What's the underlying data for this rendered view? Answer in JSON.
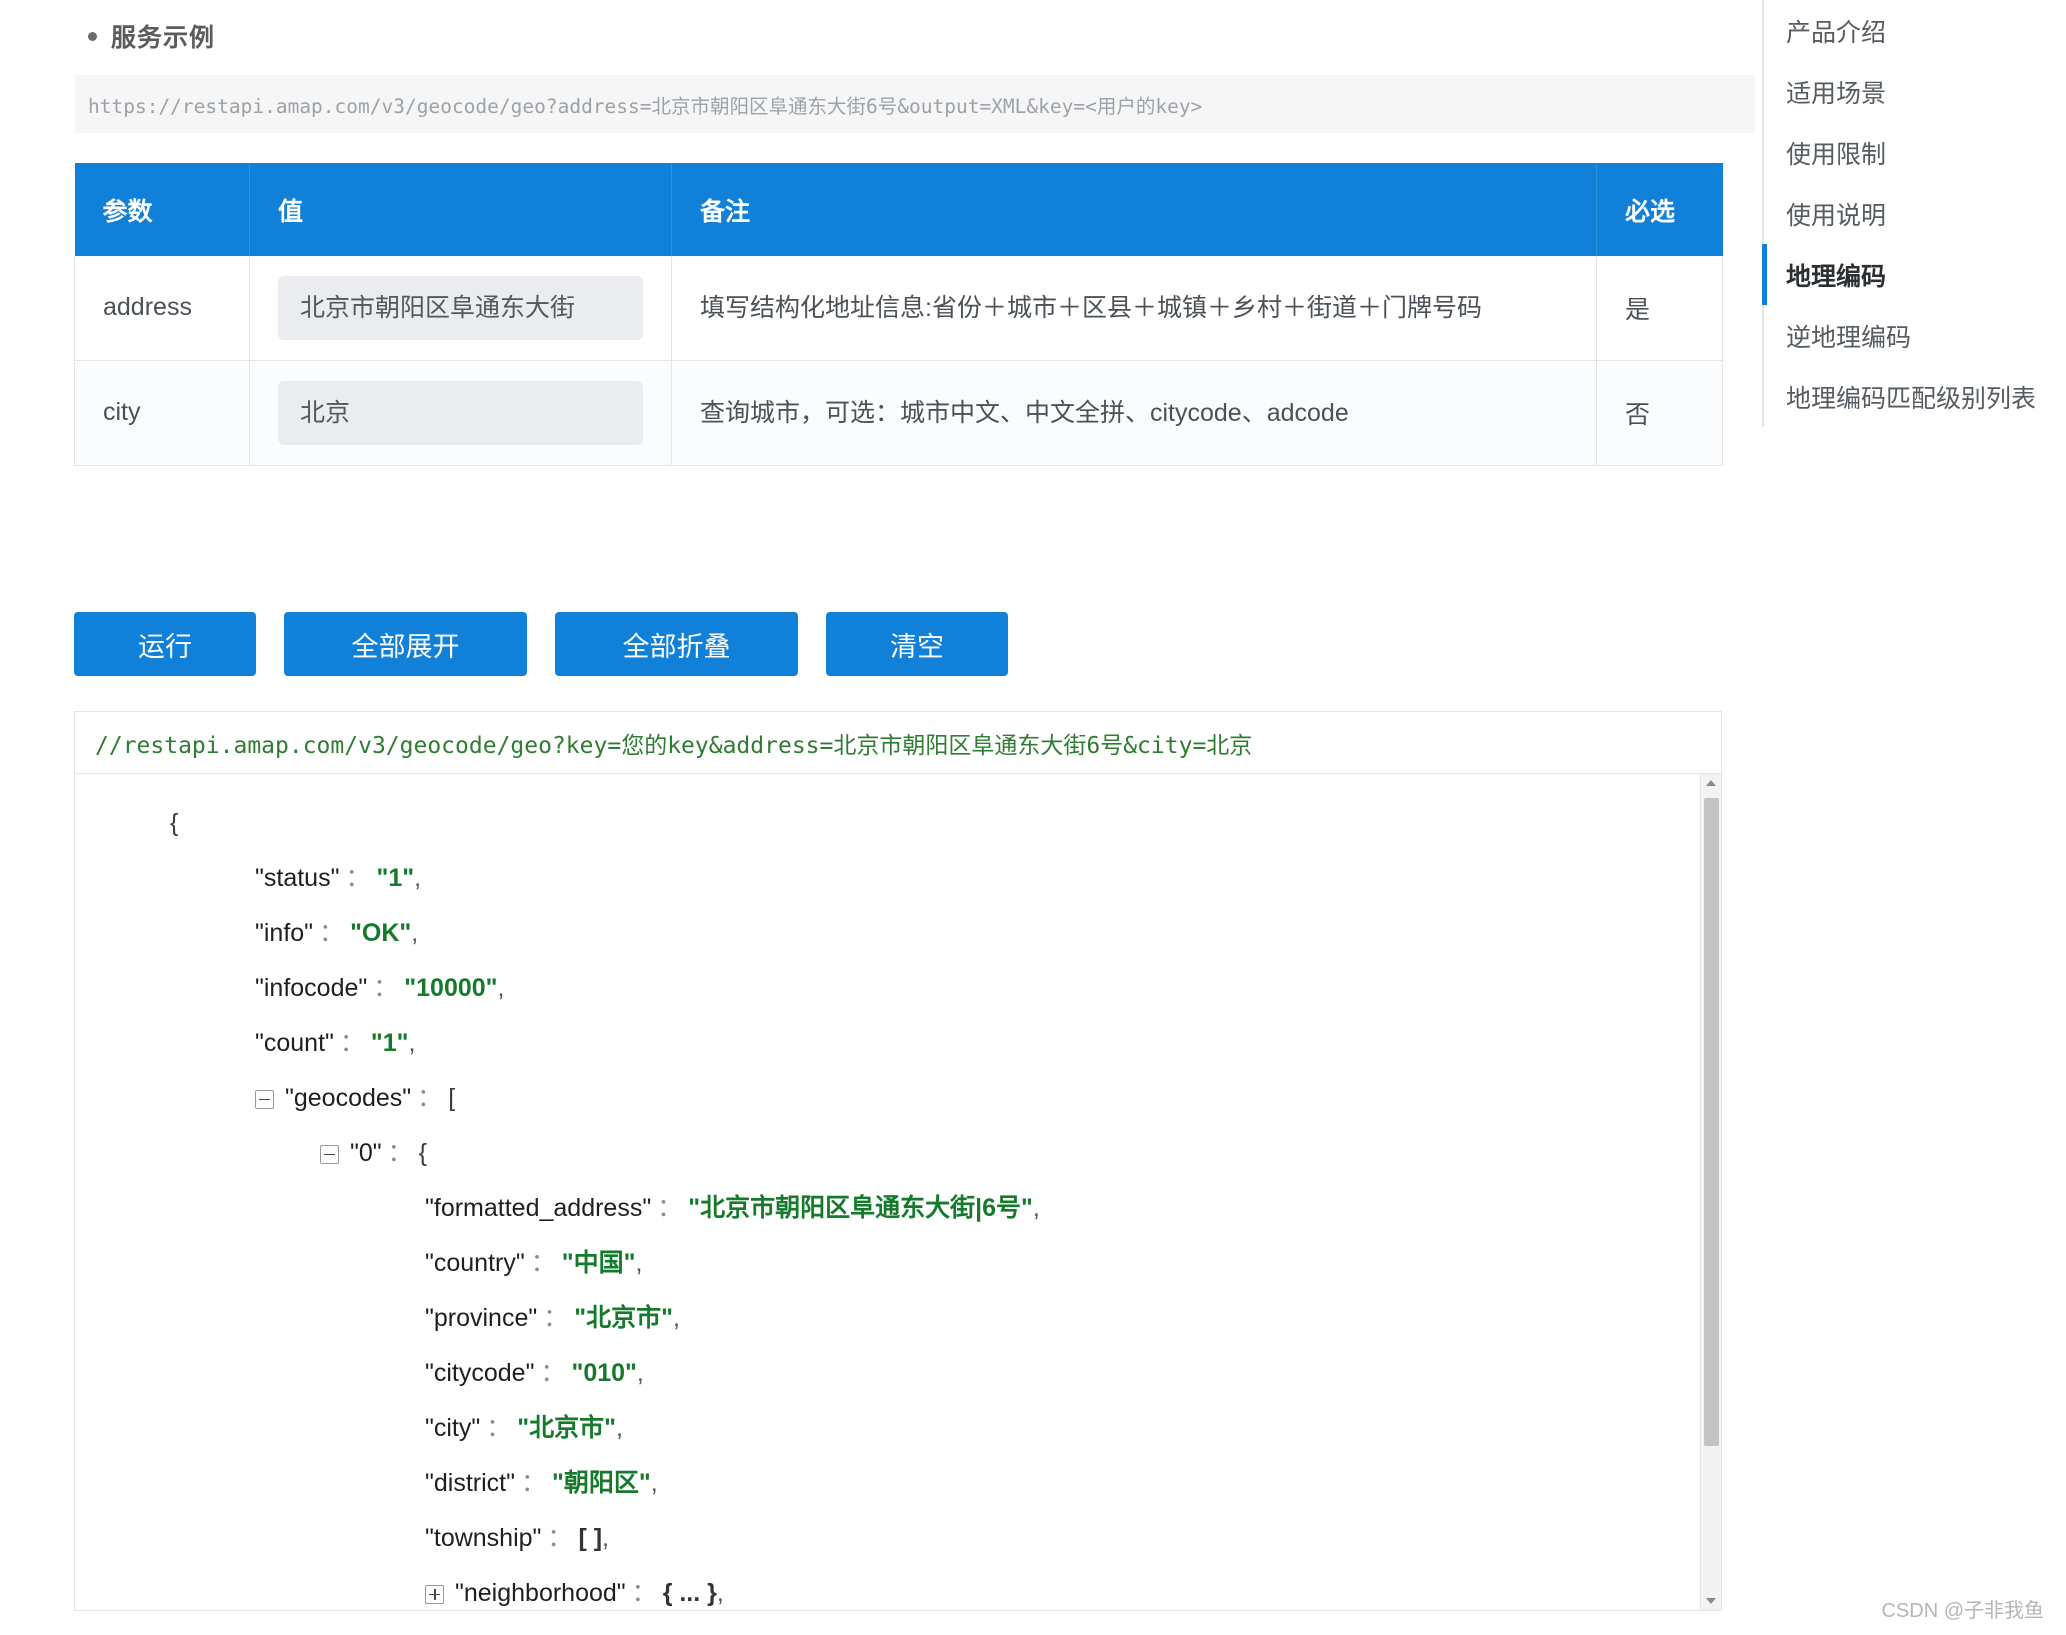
{
  "section": {
    "heading": "服务示例",
    "example_url": "https://restapi.amap.com/v3/geocode/geo?address=北京市朝阳区阜通东大街6号&output=XML&key=<用户的key>"
  },
  "param_table": {
    "headers": [
      "参数",
      "值",
      "备注",
      "必选"
    ],
    "rows": [
      {
        "param": "address",
        "value": "北京市朝阳区阜通东大街",
        "remark": "填写结构化地址信息:省份＋城市＋区县＋城镇＋乡村＋街道＋门牌号码",
        "required": "是"
      },
      {
        "param": "city",
        "value": "北京",
        "remark": "查询城市，可选：城市中文、中文全拼、citycode、adcode",
        "required": "否"
      }
    ]
  },
  "buttons": {
    "run": "运行",
    "expand_all": "全部展开",
    "collapse_all": "全部折叠",
    "clear": "清空"
  },
  "result": {
    "request_url": "//restapi.amap.com/v3/geocode/geo?key=您的key&address=北京市朝阳区阜通东大街6号&city=北京",
    "json_lines": [
      {
        "indent": 0,
        "toggle": "none",
        "key": "",
        "colon": "",
        "value": "",
        "value_type": "none",
        "open": "{",
        "trail": ""
      },
      {
        "indent": 1,
        "toggle": "none",
        "key": "\"status\"",
        "colon": "：",
        "value": "\"1\"",
        "value_type": "string",
        "open": "",
        "trail": ","
      },
      {
        "indent": 1,
        "toggle": "none",
        "key": "\"info\"",
        "colon": "：",
        "value": "\"OK\"",
        "value_type": "string",
        "open": "",
        "trail": ","
      },
      {
        "indent": 1,
        "toggle": "none",
        "key": "\"infocode\"",
        "colon": "：",
        "value": "\"10000\"",
        "value_type": "string",
        "open": "",
        "trail": ","
      },
      {
        "indent": 1,
        "toggle": "none",
        "key": "\"count\"",
        "colon": "：",
        "value": "\"1\"",
        "value_type": "string",
        "open": "",
        "trail": ","
      },
      {
        "indent": 1,
        "toggle": "minus",
        "key": "\"geocodes\"",
        "colon": "：",
        "value": "",
        "value_type": "none",
        "open": "[",
        "trail": ""
      },
      {
        "indent": 2,
        "toggle": "minus",
        "key": "\"0\"",
        "colon": "：",
        "value": "",
        "value_type": "none",
        "open": "{",
        "trail": ""
      },
      {
        "indent": 3,
        "toggle": "none",
        "key": "\"formatted_address\"",
        "colon": "：",
        "value": "\"北京市朝阳区阜通东大街|6号\"",
        "value_type": "string",
        "open": "",
        "trail": ","
      },
      {
        "indent": 3,
        "toggle": "none",
        "key": "\"country\"",
        "colon": "：",
        "value": "\"中国\"",
        "value_type": "string",
        "open": "",
        "trail": ","
      },
      {
        "indent": 3,
        "toggle": "none",
        "key": "\"province\"",
        "colon": "：",
        "value": "\"北京市\"",
        "value_type": "string",
        "open": "",
        "trail": ","
      },
      {
        "indent": 3,
        "toggle": "none",
        "key": "\"citycode\"",
        "colon": "：",
        "value": "\"010\"",
        "value_type": "string",
        "open": "",
        "trail": ","
      },
      {
        "indent": 3,
        "toggle": "none",
        "key": "\"city\"",
        "colon": "：",
        "value": "\"北京市\"",
        "value_type": "string",
        "open": "",
        "trail": ","
      },
      {
        "indent": 3,
        "toggle": "none",
        "key": "\"district\"",
        "colon": "：",
        "value": "\"朝阳区\"",
        "value_type": "string",
        "open": "",
        "trail": ","
      },
      {
        "indent": 3,
        "toggle": "none",
        "key": "\"township\"",
        "colon": "：",
        "value": "[ ]",
        "value_type": "empty",
        "open": "",
        "trail": ","
      },
      {
        "indent": 3,
        "toggle": "plus",
        "key": "\"neighborhood\"",
        "colon": "：",
        "value": "{ ... }",
        "value_type": "empty",
        "open": "",
        "trail": ","
      }
    ]
  },
  "toc": {
    "items": [
      {
        "label": "产品介绍",
        "active": false
      },
      {
        "label": "适用场景",
        "active": false
      },
      {
        "label": "使用限制",
        "active": false
      },
      {
        "label": "使用说明",
        "active": false
      },
      {
        "label": "地理编码",
        "active": true
      },
      {
        "label": "逆地理编码",
        "active": false
      },
      {
        "label": "地理编码匹配级别列表",
        "active": false
      }
    ]
  },
  "watermark": "CSDN @子非我鱼",
  "colors": {
    "accent_blue": "#1080d8",
    "json_value_green": "#157a2b",
    "request_url_green": "#2e7d32",
    "input_bg": "#eaecef"
  }
}
